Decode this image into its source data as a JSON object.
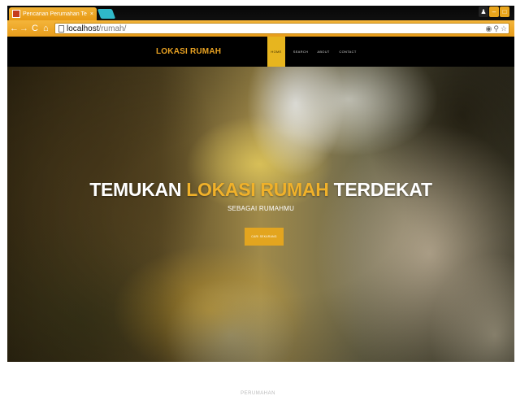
{
  "browser": {
    "tab_title": "Pencarian Perumahan Te",
    "tab_close": "×",
    "url_host": "localhost",
    "url_path": "/rumah/",
    "window_controls": {
      "minimize": "–",
      "maximize": "□",
      "user": "♟"
    },
    "icons": [
      "back-icon",
      "forward-icon",
      "reload-icon",
      "home-icon",
      "page-icon",
      "settings-icon",
      "zoom-icon",
      "star-icon"
    ],
    "accent_color": "#e9a51c"
  },
  "site": {
    "brand": "LOKASI RUMAH",
    "nav": {
      "home": "HOME",
      "search": "SEARCH",
      "about": "ABOUT",
      "contact": "CONTACT"
    },
    "hero": {
      "title_part1": "TEMUKAN",
      "title_accent": "LOKASI RUMAH",
      "title_part3": "TERDEKAT",
      "subtitle": "SEBAGAI RUMAHMU",
      "button_label": "CARI SEKARANG"
    },
    "below_heading": "PERUMAHAN",
    "accent_color": "#f0b12a"
  }
}
